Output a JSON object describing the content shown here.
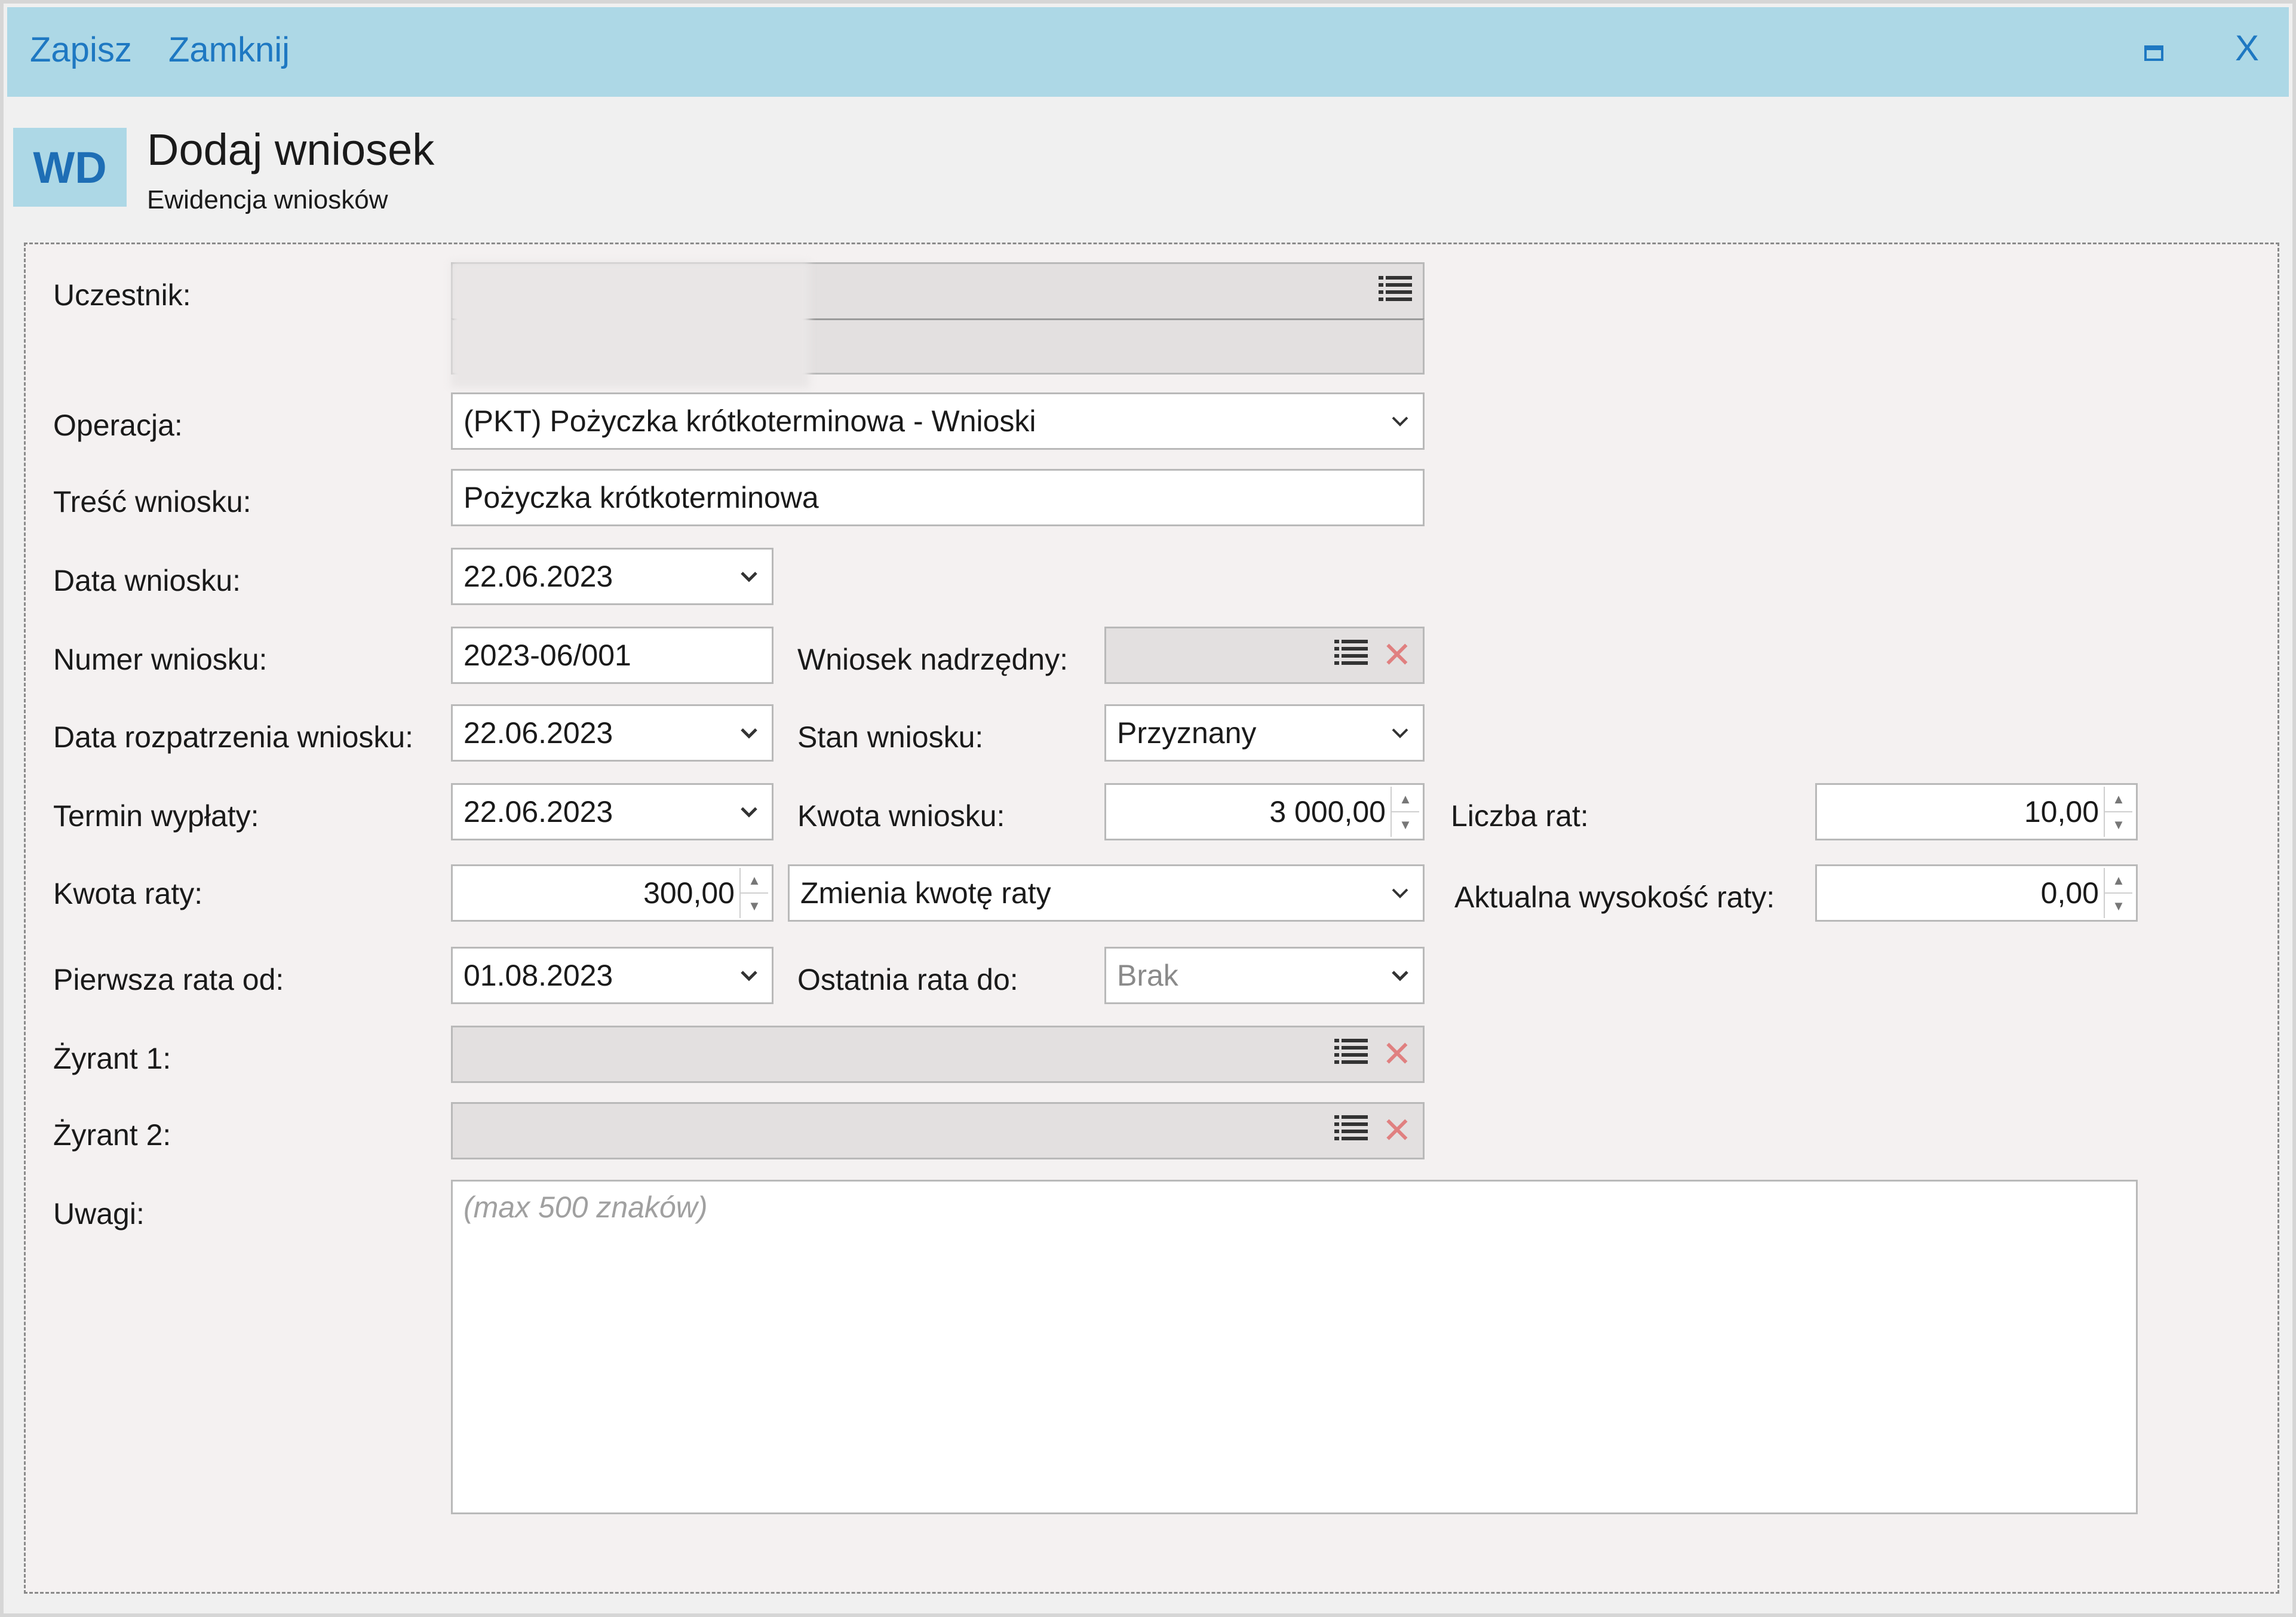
{
  "toolbar": {
    "save_label": "Zapisz",
    "close_label": "Zamknij",
    "close_window_label": "X"
  },
  "header": {
    "tile_text": "WD",
    "title": "Dodaj wniosek",
    "subtitle": "Ewidencja wniosków"
  },
  "form": {
    "participant": {
      "label": "Uczestnik:",
      "line1": "",
      "line2": ""
    },
    "operation": {
      "label": "Operacja:",
      "value": "(PKT) Pożyczka krótkoterminowa - Wnioski"
    },
    "content": {
      "label": "Treść wniosku:",
      "value": "Pożyczka krótkoterminowa"
    },
    "request_date": {
      "label": "Data wniosku:",
      "value": "22.06.2023"
    },
    "request_number": {
      "label": "Numer wniosku:",
      "value": "2023-06/001"
    },
    "parent_request": {
      "label": "Wniosek nadrzędny:",
      "value": ""
    },
    "review_date": {
      "label": "Data rozpatrzenia wniosku:",
      "value": "22.06.2023"
    },
    "status": {
      "label": "Stan wniosku:",
      "value": "Przyznany"
    },
    "payout_date": {
      "label": "Termin wypłaty:",
      "value": "22.06.2023"
    },
    "amount": {
      "label": "Kwota wniosku:",
      "value": "3 000,00"
    },
    "installments_count": {
      "label": "Liczba rat:",
      "value": "10,00"
    },
    "installment_amount": {
      "label": "Kwota raty:",
      "value": "300,00"
    },
    "installment_mode": {
      "value": "Zmienia kwotę raty"
    },
    "current_installment": {
      "label": "Aktualna wysokość raty:",
      "value": "0,00"
    },
    "first_installment": {
      "label": "Pierwsza rata od:",
      "value": "01.08.2023"
    },
    "last_installment": {
      "label": "Ostatnia rata do:",
      "value": "Brak"
    },
    "guarantor1": {
      "label": "Żyrant 1:",
      "value": ""
    },
    "guarantor2": {
      "label": "Żyrant 2:",
      "value": ""
    },
    "notes": {
      "label": "Uwagi:",
      "placeholder": "(max 500 znaków)"
    }
  }
}
